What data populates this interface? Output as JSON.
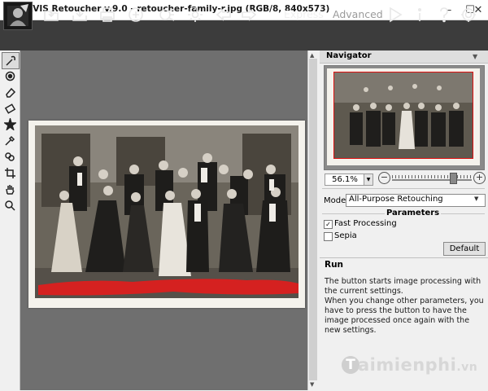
{
  "window": {
    "title": "AKVIS Retoucher v.9.0 - retoucher-family-r.jpg (RGB/8, 840x573)",
    "minimize": "–",
    "maximize": "☐",
    "close": "✕"
  },
  "toolbar": {
    "tools": [
      "open-icon",
      "save-icon",
      "print-icon",
      "share-icon",
      "batch-icon",
      "settings-icon",
      "undo-icon",
      "redo-icon"
    ],
    "mode_express": "Express",
    "mode_advanced": "Advanced",
    "right_icons": [
      "run-icon",
      "info-icon",
      "help-icon",
      "preferences-icon"
    ]
  },
  "left_tools": [
    "selection-brush-icon",
    "color-picker-icon",
    "eraser-icon",
    "magic-eraser-icon",
    "star-icon",
    "eyedropper-icon",
    "chain-icon",
    "crop-icon",
    "hand-icon",
    "zoom-icon"
  ],
  "navigator": {
    "title": "Navigator",
    "zoom": "56.1%",
    "zoom_level": 0.77
  },
  "settings": {
    "mode_label": "Mode:",
    "mode_value": "All-Purpose Retouching",
    "parameters_title": "Parameters",
    "fast_processing": {
      "label": "Fast Processing",
      "checked": true
    },
    "sepia": {
      "label": "Sepia",
      "checked": false
    },
    "default_button": "Default"
  },
  "help": {
    "title": "Run",
    "text": "The button starts image processing with the current settings.\nWhen you change other parameters, you have to press the button to have the image processed once again with the new settings."
  },
  "watermark": {
    "letter": "T",
    "text": "aimienphi",
    "suffix": ".vn"
  },
  "colors": {
    "toolbar": "#3c3c3c",
    "canvas": "#6f6f6f",
    "selection": "#e11d1d",
    "accent": "#d11111"
  }
}
